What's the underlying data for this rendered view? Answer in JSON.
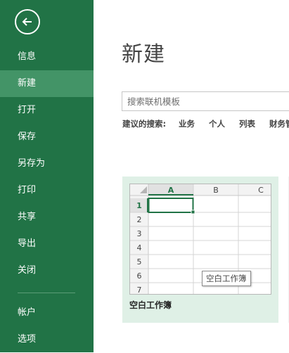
{
  "sidebar": {
    "back_icon": "arrow-left-circle-icon",
    "items": [
      {
        "label": "信息",
        "active": false
      },
      {
        "label": "新建",
        "active": true
      },
      {
        "label": "打开",
        "active": false
      },
      {
        "label": "保存",
        "active": false
      },
      {
        "label": "另存为",
        "active": false
      },
      {
        "label": "打印",
        "active": false
      },
      {
        "label": "共享",
        "active": false
      },
      {
        "label": "导出",
        "active": false
      },
      {
        "label": "关闭",
        "active": false
      }
    ],
    "bottom_items": [
      {
        "label": "帐户"
      },
      {
        "label": "选项"
      }
    ]
  },
  "main": {
    "title": "新建",
    "search": {
      "placeholder": "搜索联机模板",
      "value": ""
    },
    "suggested": {
      "label": "建议的搜索:",
      "terms": [
        "业务",
        "个人",
        "列表",
        "财务管"
      ]
    },
    "templates": [
      {
        "label": "空白工作簿",
        "tooltip": "空白工作簿",
        "preview": {
          "columns": [
            "A",
            "B",
            "C"
          ],
          "rows": [
            "1",
            "2",
            "3",
            "4",
            "5",
            "6",
            "7"
          ],
          "selected_cell": "A1"
        }
      }
    ]
  },
  "colors": {
    "sidebar_bg": "#217346",
    "sidebar_active": "#439467",
    "card_bg": "#dff0e6",
    "accent_green": "#217346"
  }
}
